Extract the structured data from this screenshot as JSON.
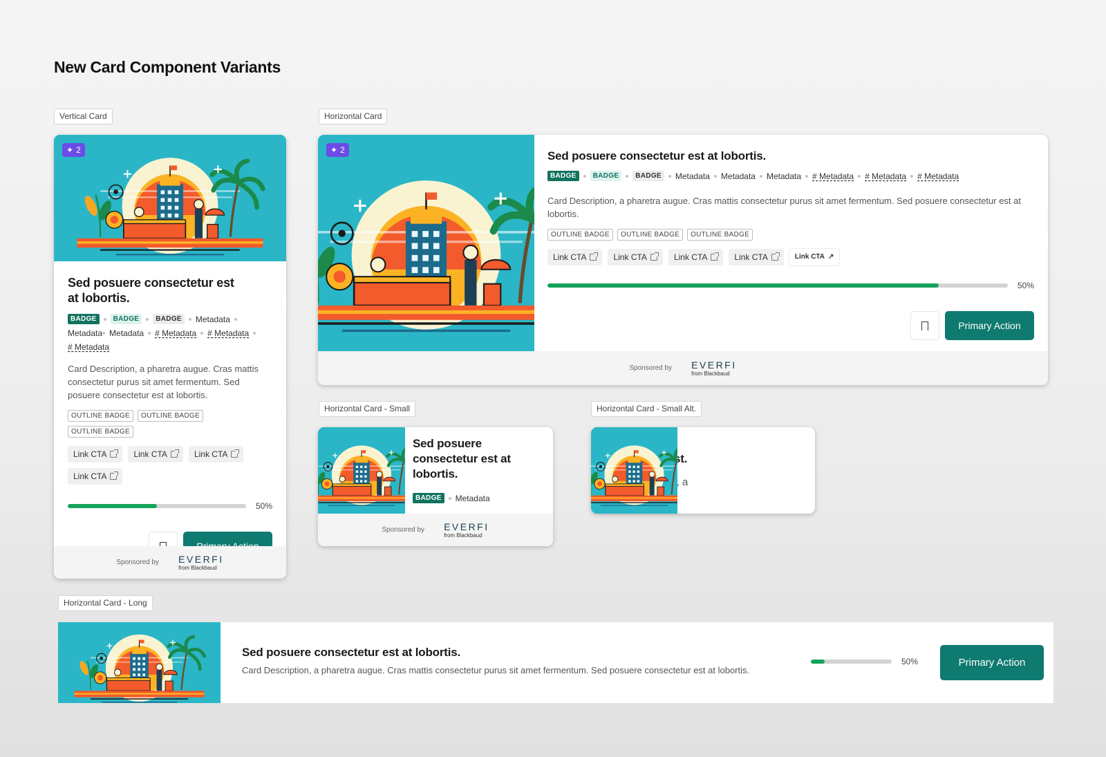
{
  "page_title": "New Card Component Variants",
  "sections": {
    "vertical": "Vertical Card",
    "horizontal": "Horizontal Card",
    "horizontal_small": "Horizontal Card - Small",
    "horizontal_small_alt": "Horizontal Card - Small Alt.",
    "horizontal_long": "Horizontal Card - Long"
  },
  "common": {
    "count": "2",
    "title": "Sed posuere consectetur est at lobortis.",
    "title_short": "Sed posuere consectetur est.",
    "badge": "BADGE",
    "metadata": "Metadata",
    "metadata_link": "# Metadata",
    "outline_badge": "OUTLINE BADGE",
    "link_cta": "Link CTA",
    "progress_value": 0.5,
    "progress_label": "50%",
    "primary_action": "Primary Action",
    "sponsored_by": "Sponsored by",
    "logo_word": "EVERFI",
    "logo_sub": "from Blackbaud"
  },
  "vertical_card": {
    "description": "Card Description, a pharetra augue. Cras mattis consectetur purus sit amet fermentum. Sed posuere consectetur est at lobortis."
  },
  "horizontal_card": {
    "description": "Card Description, a pharetra augue. Cras mattis consectetur purus sit amet fermentum. Sed posuere consectetur est at lobortis.",
    "progress_value": 0.85
  },
  "small_alt_card": {
    "description": "Card Description, a pharetra augue."
  },
  "long_card": {
    "description": "Card Description, a pharetra augue. Cras mattis consectetur purus sit amet fermentum. Sed posuere consectetur est at lobortis.",
    "progress_value": 0.17
  },
  "colors": {
    "primary": "#0e7a70",
    "progress": "#15a35a",
    "illustration_bg": "#2ab6c6",
    "count_badge": "#6b4ce6"
  },
  "icons": [
    "sparkle-icon",
    "external-link-icon",
    "arrow-up-right-icon",
    "bookmark-icon"
  ]
}
